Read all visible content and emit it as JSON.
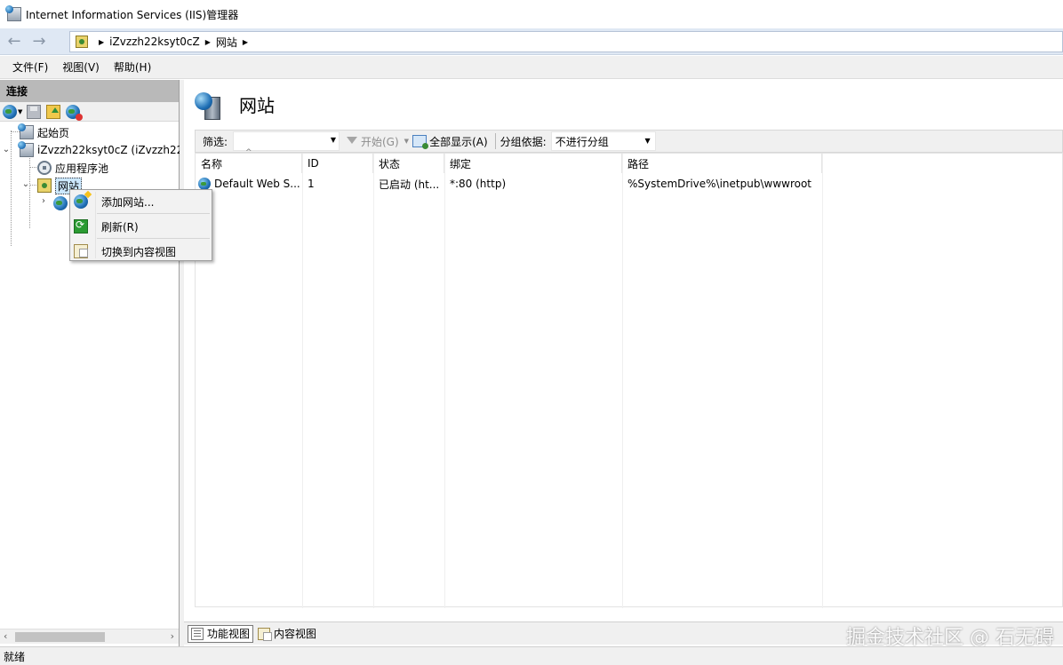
{
  "window": {
    "title": "Internet Information Services (IIS)管理器"
  },
  "address": {
    "back_icon": "back-arrow-icon",
    "forward_icon": "forward-arrow-icon",
    "crumbs": [
      "iZvzzh22ksyt0cZ",
      "网站"
    ]
  },
  "menu": {
    "items": [
      "文件(F)",
      "视图(V)",
      "帮助(H)"
    ]
  },
  "connections": {
    "header": "连接",
    "tree": {
      "start_page": "起始页",
      "server": "iZvzzh22ksyt0cZ (iZvzzh22k",
      "app_pools": "应用程序池",
      "sites": "网站"
    }
  },
  "context_menu": {
    "items": [
      "添加网站...",
      "刷新(R)",
      "切换到内容视图"
    ]
  },
  "main": {
    "title": "网站",
    "filter": {
      "label": "筛选:",
      "start_label": "开始(G)",
      "show_all_label": "全部显示(A)",
      "group_label": "分组依据:",
      "group_value": "不进行分组"
    },
    "columns": [
      "名称",
      "ID",
      "状态",
      "绑定",
      "路径"
    ],
    "rows": [
      {
        "name": "Default Web S...",
        "id": "1",
        "status": "已启动 (ht...",
        "binding": "*:80 (http)",
        "path": "%SystemDrive%\\inetpub\\wwwroot"
      }
    ]
  },
  "bottom_tabs": {
    "features": "功能视图",
    "content": "内容视图"
  },
  "watermark": "掘金技术社区 @ 石无碍",
  "status": {
    "text": "就绪"
  }
}
